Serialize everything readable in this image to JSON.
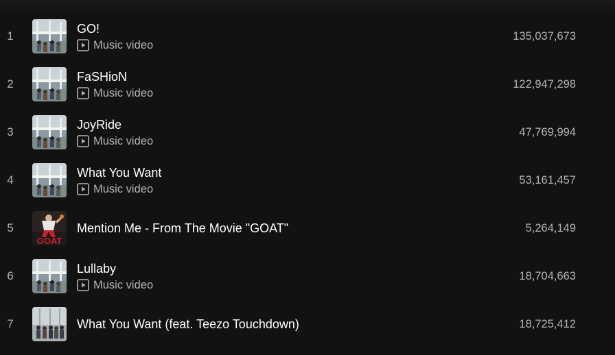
{
  "tracks": [
    {
      "index": "1",
      "title": "GO!",
      "subtitle": "Music video",
      "has_video": true,
      "plays": "135,037,673",
      "art": "group-photo"
    },
    {
      "index": "2",
      "title": "FaSHioN",
      "subtitle": "Music video",
      "has_video": true,
      "plays": "122,947,298",
      "art": "group-photo"
    },
    {
      "index": "3",
      "title": "JoyRide",
      "subtitle": "Music video",
      "has_video": true,
      "plays": "47,769,994",
      "art": "group-photo"
    },
    {
      "index": "4",
      "title": "What You Want",
      "subtitle": "Music video",
      "has_video": true,
      "plays": "53,161,457",
      "art": "group-photo"
    },
    {
      "index": "5",
      "title": "Mention Me - From The Movie \"GOAT\"",
      "subtitle": "",
      "has_video": false,
      "plays": "5,264,149",
      "art": "goat-poster"
    },
    {
      "index": "6",
      "title": "Lullaby",
      "subtitle": "Music video",
      "has_video": true,
      "plays": "18,704,663",
      "art": "group-photo"
    },
    {
      "index": "7",
      "title": "What You Want (feat. Teezo Touchdown)",
      "subtitle": "",
      "has_video": false,
      "plays": "18,725,412",
      "art": "group-photo-alt"
    }
  ],
  "colors": {
    "background": "#121212",
    "primary_text": "#ffffff",
    "secondary_text": "#b3b3b3",
    "goat_red": "#c8202a"
  }
}
